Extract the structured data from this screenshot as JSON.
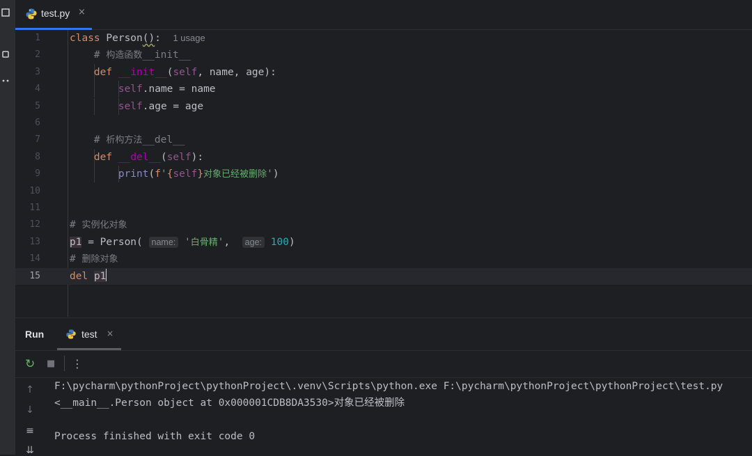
{
  "editor_tab": {
    "label": "test.py",
    "close": "×"
  },
  "code_lines": [
    {
      "num": "1",
      "html": "<span class=\"kw\">class</span> Person<span class=\"wavy\">()</span>:  <span class=\"hint\">1 usage</span>"
    },
    {
      "num": "2",
      "html": "    <span class=\"cmt\"># <span class=\"cjk\">构造函数</span>__init__</span>"
    },
    {
      "num": "3",
      "html": "    <span class=\"kw\">def</span> <span class=\"mag\">__init__</span>(<span class=\"slf\">self</span>, name, age):"
    },
    {
      "num": "4",
      "html": "        <span class=\"slf\">self</span>.name = name"
    },
    {
      "num": "5",
      "html": "        <span class=\"slf\">self</span>.age = age"
    },
    {
      "num": "6",
      "html": ""
    },
    {
      "num": "7",
      "html": "    <span class=\"cmt\"># <span class=\"cjk\">析构方法</span>__del__</span>"
    },
    {
      "num": "8",
      "html": "    <span class=\"kw\">def</span> <span class=\"mag\">__del__</span>(<span class=\"slf\">self</span>):"
    },
    {
      "num": "9",
      "html": "        <span class=\"bi\">print</span>(<span class=\"kw\">f</span><span class=\"str\">'</span><span class=\"kw\">{</span><span class=\"slf\">self</span><span class=\"kw\">}</span><span class=\"str\"><span class=\"cjk\">对象已经被删除</span>'</span>)"
    },
    {
      "num": "10",
      "html": ""
    },
    {
      "num": "11",
      "html": ""
    },
    {
      "num": "12",
      "html": "<span class=\"cmt\"># <span class=\"cjk\">实例化对象</span></span>"
    },
    {
      "num": "13",
      "html": "<span class=\"hl\">p1</span> = Person( <span class=\"inlay\">name:</span> <span class=\"str\">'<span class=\"cjk\">白骨精</span>'</span>,  <span class=\"inlay\">age:</span> <span class=\"num\">100</span>)"
    },
    {
      "num": "14",
      "html": "<span class=\"cmt\"># <span class=\"cjk\">删除对象</span></span>"
    },
    {
      "num": "15",
      "html": "<span class=\"kw\">del</span> <span class=\"hl\">p1</span><span class=\"caret\"></span>"
    }
  ],
  "run_panel": {
    "title": "Run",
    "tab_label": "test",
    "tab_close": "×",
    "output": [
      "F:\\pycharm\\pythonProject\\pythonProject\\.venv\\Scripts\\python.exe F:\\pycharm\\pythonProject\\pythonProject\\test.py",
      "<__main__.Person object at 0x000001CDB8DA3530>对象已经被删除",
      "",
      "Process finished with exit code 0"
    ]
  },
  "icons": {
    "rerun": "↻",
    "stop": "■",
    "more": "⋮",
    "up": "↑",
    "down": "↓",
    "soft_wrap": "≡",
    "scroll_end": "⇊"
  }
}
